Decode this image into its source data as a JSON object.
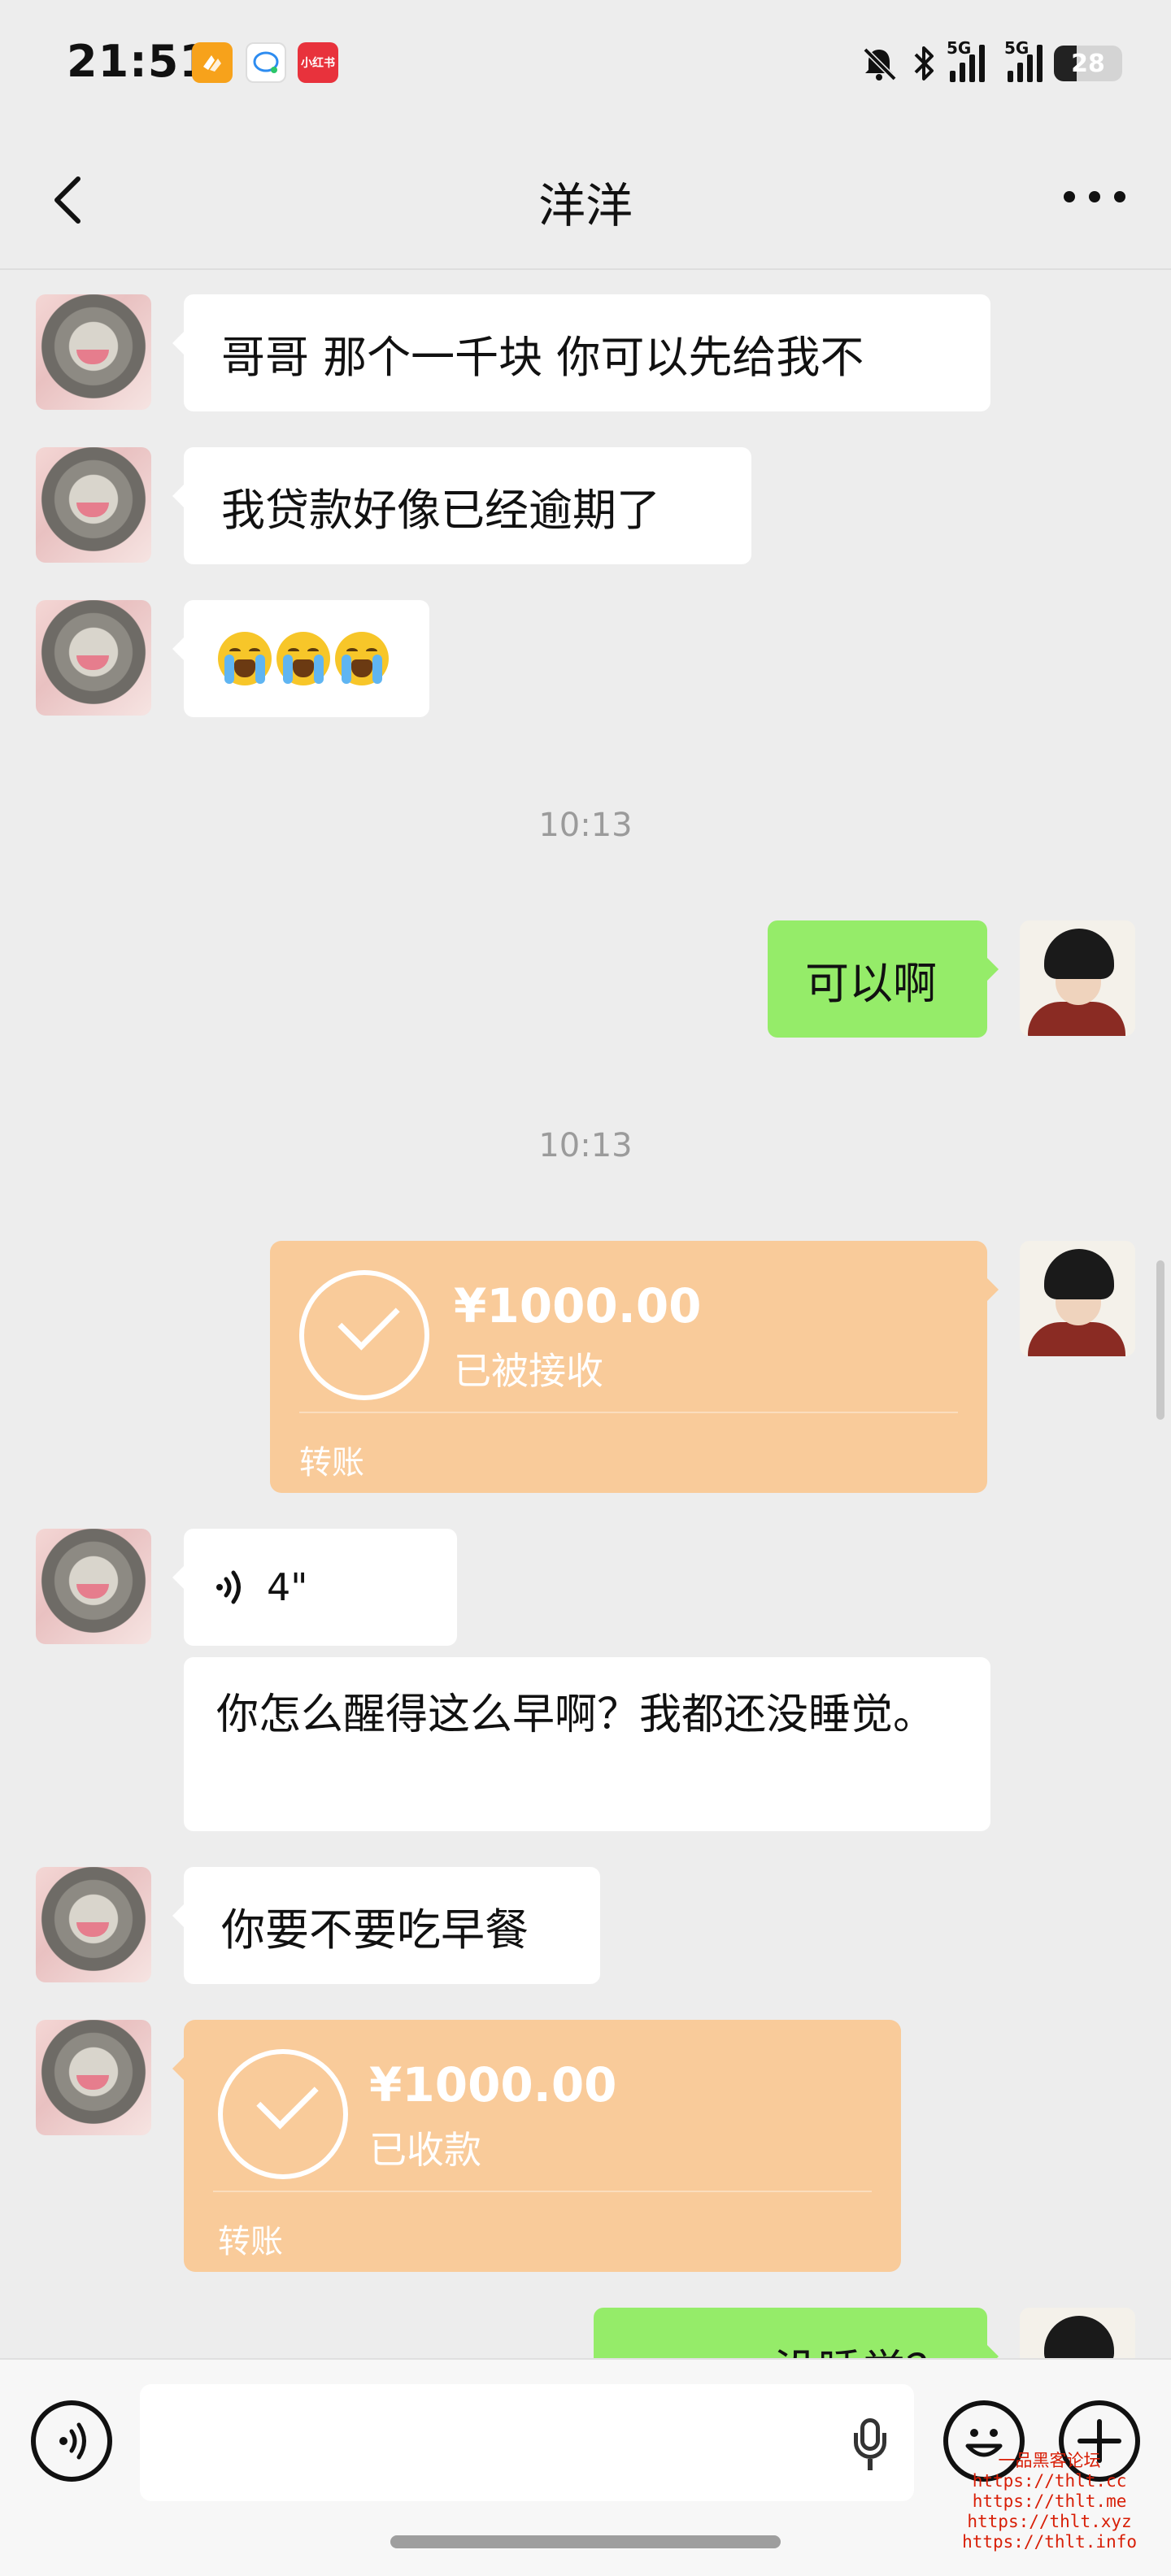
{
  "status_bar": {
    "time": "21:51",
    "apps": [
      {
        "name": "orange-app-icon",
        "color": "#f7a21b",
        "text": ""
      },
      {
        "name": "qq-app-icon",
        "color": "#ffffff",
        "text": ""
      },
      {
        "name": "xiaohongshu-app-icon",
        "color": "#e8323c",
        "text": "小红书"
      }
    ],
    "signal_1": "5G",
    "signal_2": "5G",
    "battery": "28"
  },
  "nav": {
    "title": "洋洋"
  },
  "messages": {
    "m1": "哥哥 那个一千块 你可以先给我不",
    "m2": "我贷款好像已经逾期了",
    "m3_emoji": "loudly-crying-emoji x3",
    "ts1": "10:13",
    "m4": "可以啊",
    "ts2": "10:13",
    "transfer_out": {
      "amount": "¥1000.00",
      "status": "已被接收",
      "label": "转账"
    },
    "voice": {
      "duration": "4\""
    },
    "voice_transcript": "你怎么醒得这么早啊？我都还没睡觉。",
    "m6": "你要不要吃早餐",
    "transfer_in": {
      "amount": "¥1000.00",
      "status": "已收款",
      "label": "转账"
    },
    "m7_partial": "没睡觉？"
  },
  "colors": {
    "background": "#ededed",
    "incoming_bubble": "#ffffff",
    "outgoing_bubble": "#95ec69",
    "transfer_card": "#f9cb9a"
  },
  "watermark": {
    "title": "一品黑客论坛",
    "urls": [
      "https://thlt.cc",
      "https://thlt.me",
      "https://thlt.xyz",
      "https://thlt.info"
    ]
  }
}
